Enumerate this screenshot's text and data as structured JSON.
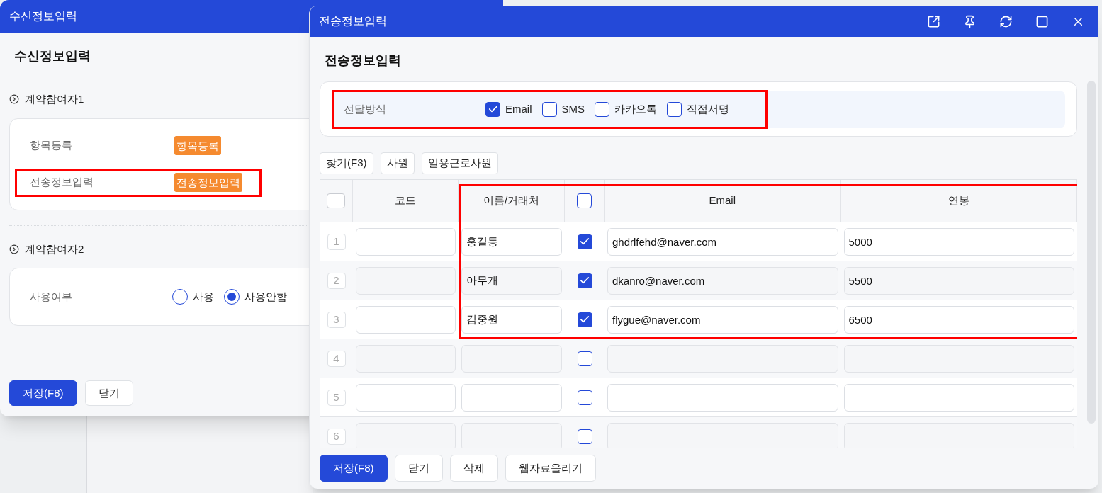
{
  "back_window": {
    "title": "수신정보입력",
    "heading": "수신정보입력",
    "sections": [
      {
        "title": "계약참여자1",
        "rows": [
          {
            "kind": "tag",
            "label": "항목등록",
            "tag": "항목등록",
            "highlighted": false
          },
          {
            "kind": "tag",
            "label": "전송정보입력",
            "tag": "전송정보입력",
            "highlighted": true
          }
        ]
      },
      {
        "title": "계약참여자2",
        "rows": [
          {
            "kind": "radio",
            "label": "사용여부",
            "options": [
              {
                "label": "사용",
                "selected": false
              },
              {
                "label": "사용안함",
                "selected": true
              }
            ]
          }
        ]
      }
    ],
    "buttons": [
      {
        "label": "저장(F8)",
        "primary": true
      },
      {
        "label": "닫기",
        "primary": false
      }
    ]
  },
  "window": {
    "title": "전송정보입력",
    "heading": "전송정보입력",
    "delivery": {
      "label": "전달방식",
      "highlighted": true,
      "options": [
        {
          "label": "Email",
          "checked": true
        },
        {
          "label": "SMS",
          "checked": false
        },
        {
          "label": "카카오톡",
          "checked": false
        },
        {
          "label": "직접서명",
          "checked": false
        }
      ]
    },
    "toolbar": [
      "찾기(F3)",
      "사원",
      "일용근로사원"
    ],
    "table": {
      "highlighted": true,
      "row_header_checkbox": {
        "checked": false
      },
      "columns": [
        {
          "kind": "text",
          "label": "코드"
        },
        {
          "kind": "text",
          "label": "이름/거래처"
        },
        {
          "kind": "checkbox",
          "checked": false
        },
        {
          "kind": "text",
          "label": "Email"
        },
        {
          "kind": "text",
          "label": "연봉"
        }
      ],
      "rows": [
        {
          "number": "1",
          "name": "홍길동",
          "checked": true,
          "email": "ghdrlfehd@naver.com",
          "salary": "5000"
        },
        {
          "number": "2",
          "name": "아무개",
          "checked": true,
          "email": "dkanro@naver.com",
          "salary": "5500"
        },
        {
          "number": "3",
          "name": "김중원",
          "checked": true,
          "email": "flygue@naver.com",
          "salary": "6500"
        },
        {
          "number": "4",
          "checked": false
        },
        {
          "number": "5",
          "checked": false
        },
        {
          "number": "6",
          "checked": false
        }
      ]
    },
    "buttons": [
      {
        "label": "저장(F8)",
        "primary": true
      },
      {
        "label": "닫기",
        "primary": false
      },
      {
        "label": "삭제",
        "primary": false
      },
      {
        "label": "웹자료올리기",
        "primary": false
      }
    ]
  }
}
